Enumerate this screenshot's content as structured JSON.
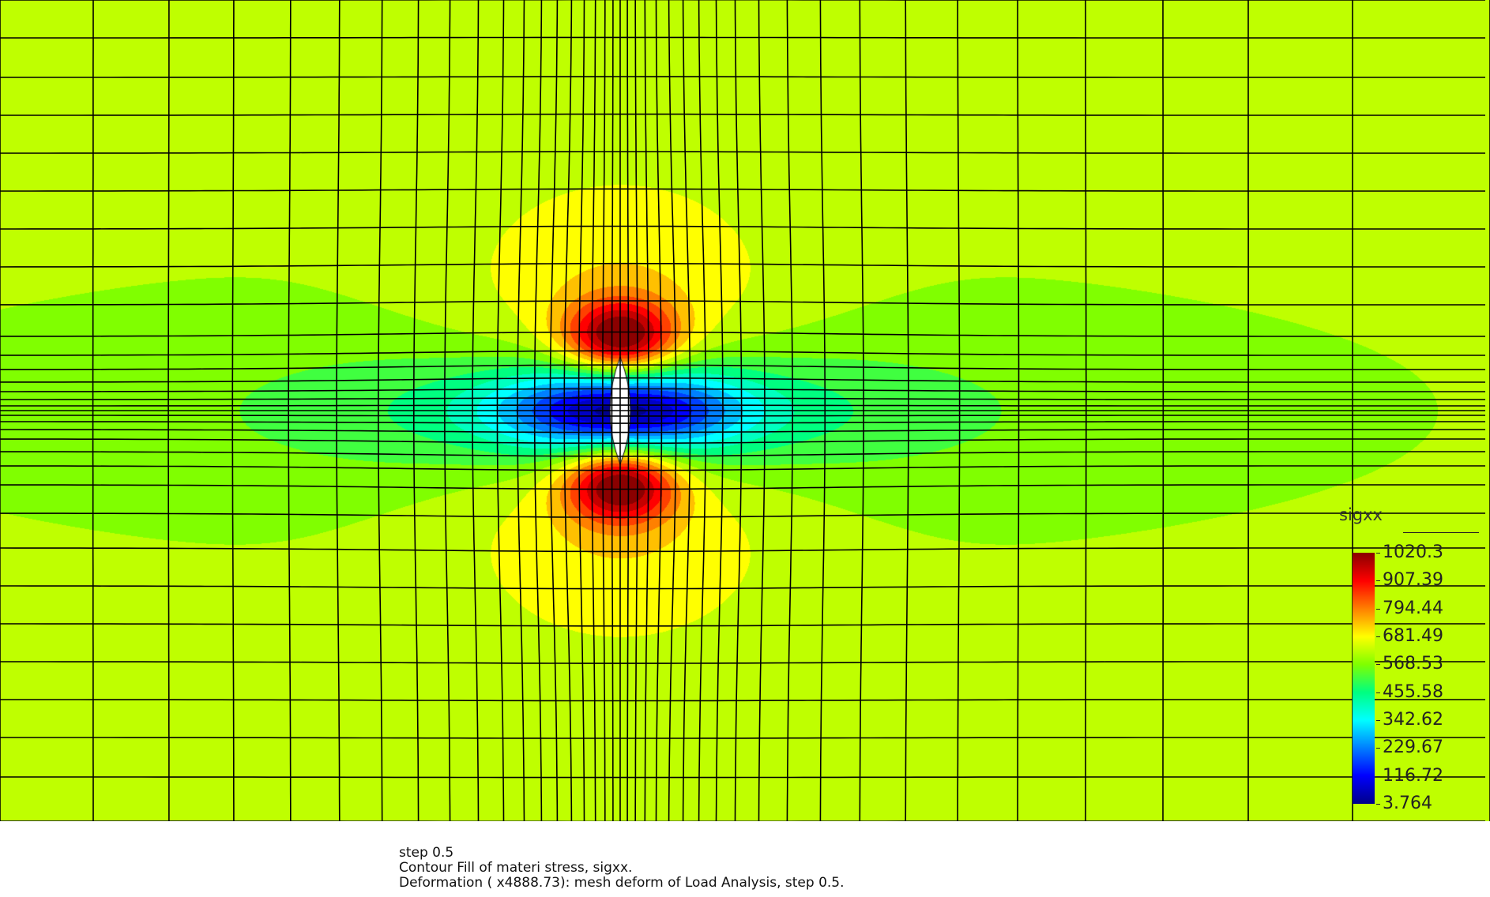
{
  "chart_data": {
    "type": "heatmap",
    "title": "sigxx",
    "field": "sigxx",
    "legend_placement": "bottom-right",
    "colormap": [
      "#00008b",
      "#0000ff",
      "#0080ff",
      "#00ffff",
      "#00ff80",
      "#80ff00",
      "#ffff00",
      "#ff8000",
      "#ff0000",
      "#8b0000"
    ],
    "range": [
      3.764,
      1020.3
    ],
    "legend_labels": [
      "1020.3",
      "907.39",
      "794.44",
      "681.49",
      "568.53",
      "455.58",
      "342.62",
      "229.67",
      "116.72",
      "3.764"
    ],
    "background_value": 600,
    "crack_center": [
      0,
      0
    ],
    "features": [
      {
        "kind": "tension-peak",
        "where": "above crack tip",
        "value": 1020.3
      },
      {
        "kind": "tension-peak",
        "where": "below crack tip",
        "value": 1020.3
      },
      {
        "kind": "stress-shadow",
        "where": "left and right of crack",
        "value": 3.764
      }
    ],
    "grid": true
  },
  "caption": {
    "line1": "step 0.5",
    "line2": "Contour Fill of materi stress, sigxx.",
    "line3": "Deformation ( x4888.73): mesh deform of Load Analysis, step 0.5."
  },
  "colors": {
    "mesh_line": "#000000",
    "background": "#ffffff",
    "crack": "#ffffff"
  }
}
